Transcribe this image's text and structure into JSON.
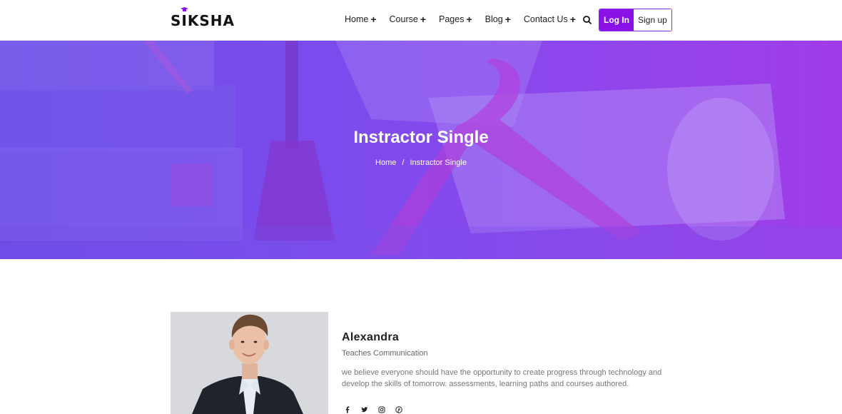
{
  "header": {
    "logo_text": "SIKSHA",
    "nav": [
      {
        "label": "Home"
      },
      {
        "label": "Course"
      },
      {
        "label": "Pages"
      },
      {
        "label": "Blog"
      },
      {
        "label": "Contact Us"
      }
    ],
    "nav_suffix": "+",
    "login_label": "Log In",
    "signup_label": "Sign up"
  },
  "hero": {
    "title": "Instractor Single",
    "breadcrumb": {
      "home": "Home",
      "separator": "/",
      "current": "Instractor Single"
    }
  },
  "instructor": {
    "name": "Alexandra",
    "role": "Teaches Communication",
    "bio": "we believe everyone should have the opportunity to create progress through technology and develop the skills of tomorrow. assessments, learning paths and courses authored.",
    "socials": [
      "facebook-icon",
      "twitter-icon",
      "instagram-icon",
      "pinterest-icon"
    ]
  },
  "colors": {
    "brand_purple": "#8a12e6",
    "hero_start": "#6d4fe6",
    "hero_end": "#a33ce6"
  }
}
